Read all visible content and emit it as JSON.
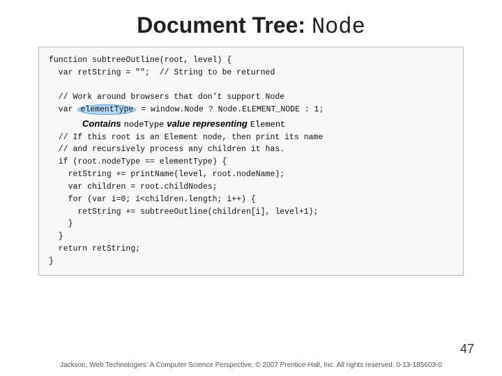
{
  "header": {
    "title_text": "Document Tree: ",
    "title_mono": "Node"
  },
  "code": {
    "lines": [
      "function subtreeOutline(root, level) {",
      "  var retString = \"\";  // String to be returned",
      "",
      "  // Work around browsers that don't support Node",
      "  var ",
      " = window.Node ? Node.ELEMENT_NODE : 1;",
      "  // If this root is an Element node, then print its name",
      "  // and recursively process any children it has.",
      "  if (root.nodeType == elementType) {",
      "    retString += printName(level, root.nodeName);",
      "    var children = root.childNodes;",
      "    for (var i=0; i<children.length; i++) {",
      "      retString += subtreeOutline(children[i], level+1);",
      "    }",
      "  }",
      "  return retString;",
      "}"
    ],
    "highlight_word": "elementType",
    "callout": {
      "contains": "Contains",
      "nodetype": "nodeType",
      "value": "value representing",
      "element": "Element"
    }
  },
  "page_number": "47",
  "footer": "Jackson, Web Technologies: A Computer Science Perspective, © 2007 Prentice-Hall, Inc. All rights reserved. 0-13-185603-0"
}
